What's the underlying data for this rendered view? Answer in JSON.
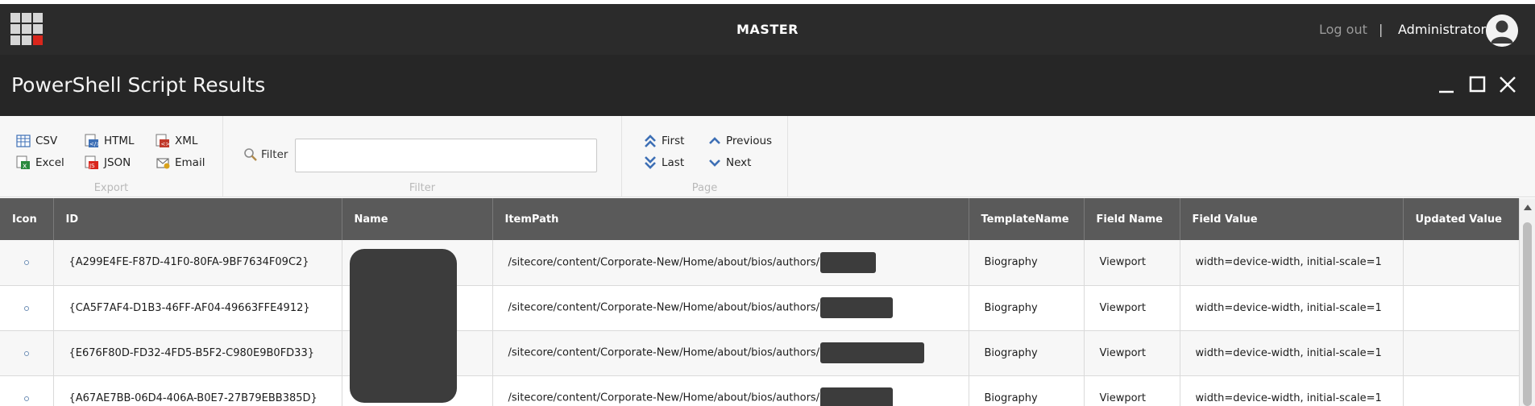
{
  "topbar": {
    "database": "MASTER",
    "logout": "Log out",
    "separator": "|",
    "username": "Administrator"
  },
  "dialog": {
    "title": "PowerShell Script Results"
  },
  "ribbon": {
    "export": {
      "label": "Export",
      "csv": "CSV",
      "excel": "Excel",
      "html": "HTML",
      "json": "JSON",
      "xml": "XML",
      "email": "Email"
    },
    "filter": {
      "label": "Filter",
      "field_label": "Filter",
      "value": ""
    },
    "page": {
      "label": "Page",
      "first": "First",
      "last": "Last",
      "previous": "Previous",
      "next": "Next"
    }
  },
  "grid": {
    "columns": [
      "Icon",
      "ID",
      "Name",
      "ItemPath",
      "TemplateName",
      "Field Name",
      "Field Value",
      "Updated Value"
    ],
    "rows": [
      {
        "id": "{A299E4FE-F87D-41F0-80FA-9BF7634F09C2}",
        "item_path": "/sitecore/content/Corporate-New/Home/about/bios/authors/",
        "template_name": "Biography",
        "field_name": "Viewport",
        "field_value": "width=device-width, initial-scale=1",
        "updated_value": ""
      },
      {
        "id": "{CA5F7AF4-D1B3-46FF-AF04-49663FFE4912}",
        "item_path": "/sitecore/content/Corporate-New/Home/about/bios/authors/",
        "template_name": "Biography",
        "field_name": "Viewport",
        "field_value": "width=device-width, initial-scale=1",
        "updated_value": ""
      },
      {
        "id": "{E676F80D-FD32-4FD5-B5F2-C980E9B0FD33}",
        "item_path": "/sitecore/content/Corporate-New/Home/about/bios/authors/",
        "template_name": "Biography",
        "field_name": "Viewport",
        "field_value": "width=device-width, initial-scale=1",
        "updated_value": ""
      },
      {
        "id": "{A67AE7BB-06D4-406A-B0E7-27B79EBB385D}",
        "item_path": "/sitecore/content/Corporate-New/Home/about/bios/authors/",
        "template_name": "Biography",
        "field_name": "Viewport",
        "field_value": "width=device-width, initial-scale=1",
        "updated_value": ""
      }
    ]
  },
  "icons": {
    "app": "app-grid-icon",
    "avatar": "user-avatar-icon",
    "minimize": "minimize-icon",
    "maximize": "maximize-icon",
    "close": "close-icon",
    "search": "magnifier-icon"
  },
  "colors": {
    "topbar": "#2b2b2b",
    "dialog_header": "#262626",
    "grid_header": "#5a5a5a",
    "accent_blue": "#3d6fb5",
    "accent_red": "#d9261c"
  }
}
